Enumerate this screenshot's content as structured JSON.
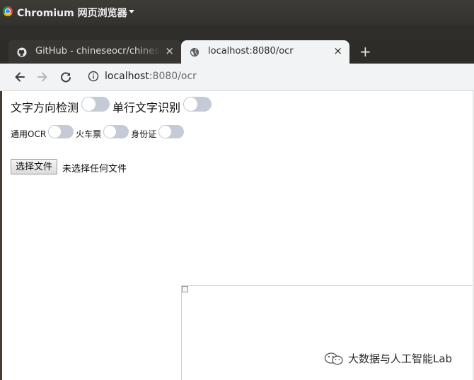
{
  "os": {
    "app_title": "Chromium 网页浏览器"
  },
  "tabs": [
    {
      "title": "GitHub - chineseocr/chineseocr",
      "close": "×",
      "icon": "github-icon",
      "active": false
    },
    {
      "title": "localhost:8080/ocr",
      "close": "×",
      "icon": "globe-icon",
      "active": true
    }
  ],
  "new_tab_label": "+",
  "toolbar": {
    "url_host": "localhost",
    "url_path": ":8080/ocr"
  },
  "page": {
    "toggle_text_direction_label": "文字方向检测",
    "toggle_single_line_label": "单行文字识别",
    "toggle_general_ocr_label": "通用OCR",
    "toggle_train_ticket_label": "火车票",
    "toggle_id_card_label": "身份证",
    "file_button_label": "选择文件",
    "file_status": "未选择任何文件"
  },
  "watermark": {
    "text": "大数据与人工智能Lab",
    "icon": "wechat-icon"
  },
  "colors": {
    "os_bar": "#3d3c37",
    "tab_strip": "#2d2c29",
    "active_tab": "#f1f3f4",
    "toggle_off": "#c5cbd6"
  }
}
